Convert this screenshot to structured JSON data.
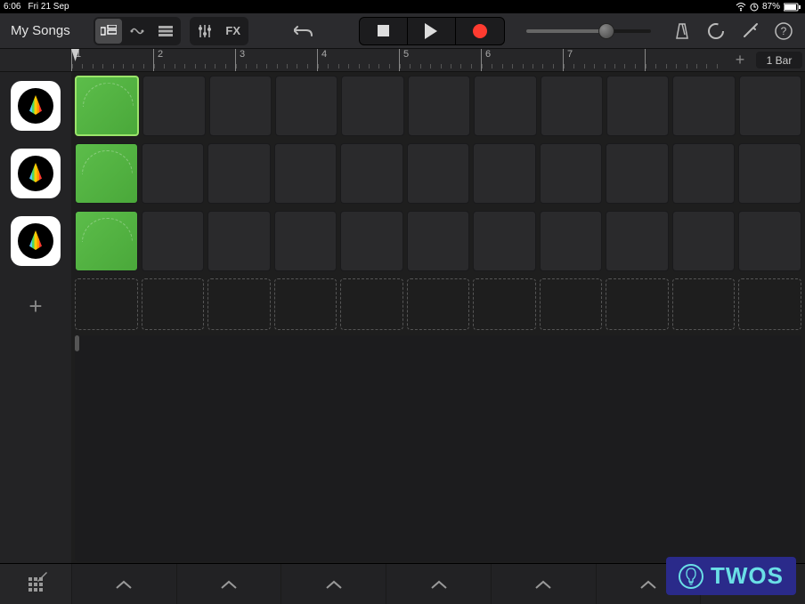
{
  "statusbar": {
    "time": "6:06",
    "date": "Fri 21 Sep",
    "wifi_icon": "wifi",
    "bluetooth_icon": "bluetooth",
    "battery_pct": "87%"
  },
  "toolbar": {
    "back_label": "My Songs",
    "view_buttons": [
      "tracks-view",
      "live-loops-view",
      "list-view"
    ],
    "active_view": "tracks-view",
    "settings_label": "",
    "fx_label": "FX",
    "undo_icon": "undo",
    "transport": {
      "stop": "stop",
      "play": "play",
      "record": "record"
    },
    "volume": 0.62,
    "metronome_icon": "metronome",
    "loop_icon": "loop",
    "wrench_icon": "settings",
    "help_icon": "help"
  },
  "ruler": {
    "bars": [
      "1",
      "2",
      "3",
      "4",
      "5",
      "6",
      "7",
      ""
    ],
    "playhead_bar": 1,
    "snap_label": "1 Bar",
    "add_label": "+"
  },
  "tracks": [
    {
      "name": "track-1",
      "instrument": "beat-sequencer",
      "cells_filled": [
        0
      ],
      "selected_cell": 0,
      "tooltip": ""
    },
    {
      "name": "track-2",
      "instrument": "beat-sequencer",
      "cells_filled": [
        0
      ],
      "selected_cell": null,
      "tooltip": ""
    },
    {
      "name": "track-3",
      "instrument": "beat-sequencer",
      "cells_filled": [
        0
      ],
      "selected_cell": null,
      "tooltip": ""
    }
  ],
  "columns": 11,
  "add_track_label": "+",
  "bottom_bar": {
    "panels": 7,
    "grid_edit_icon": "grid-edit"
  },
  "watermark": {
    "text": "TWOS",
    "icon": "lightbulb"
  }
}
